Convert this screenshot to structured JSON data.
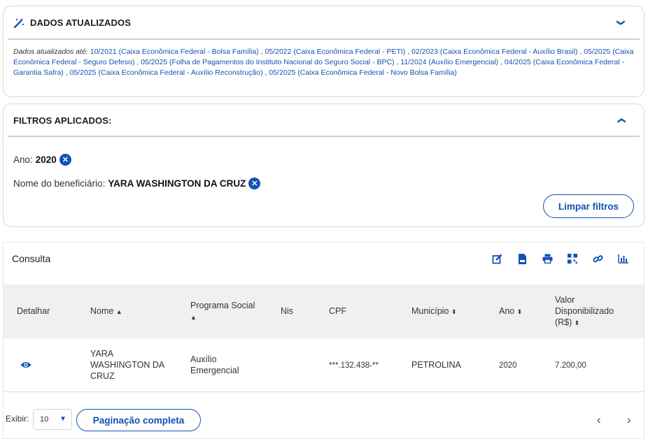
{
  "updated": {
    "title": "DADOS ATUALIZADOS",
    "lead": "Dados atualizados até:",
    "text": " 10/2021 (Caixa Econômica Federal - Bolsa Família) , 05/2022 (Caixa Econômica Federal - PETI) , 02/2023 (Caixa Econômica Federal - Auxílio Brasil) , 05/2025 (Caixa Econômica Federal - Seguro Defeso) , 05/2025 (Folha de Pagamentos do Instituto Nacional do Seguro Social - BPC) , 11/2024 (Auxílio Emergencial) , 04/2025 (Caixa Econômica Federal - Garantia Safra) , 05/2025 (Caixa Econômica Federal - Auxílio Reconstrução) , 05/2025 (Caixa Econômica Federal - Novo Bolsa Família)"
  },
  "filters": {
    "title": "FILTROS APLICADOS:",
    "items": [
      {
        "label": "Ano:",
        "value": "2020"
      },
      {
        "label": "Nome do beneficiário:",
        "value": "YARA WASHINGTON DA CRUZ"
      }
    ],
    "clear_label": "Limpar filtros"
  },
  "consulta": {
    "title": "Consulta",
    "tools": [
      "edit-icon",
      "csv-icon",
      "print-icon",
      "qr-code-icon",
      "link-icon",
      "chart-icon"
    ],
    "columns": {
      "detalhar": "Detalhar",
      "nome": "Nome",
      "programa_l1": "Programa Social",
      "nis": "Nis",
      "cpf": "CPF",
      "municipio": "Município",
      "ano": "Ano",
      "valor_l1": "Valor",
      "valor_l2": "Disponibilizado",
      "valor_l3": "(R$)"
    },
    "rows": [
      {
        "nome_l1": "YARA",
        "nome_l2": "WASHINGTON DA",
        "nome_l3": "CRUZ",
        "programa_l1": "Auxílio",
        "programa_l2": "Emergencial",
        "nis": "",
        "cpf": "***.132.438-**",
        "municipio": "PETROLINA",
        "ano": "2020",
        "valor": "7.200,00"
      }
    ]
  },
  "pager": {
    "exibir_label": "Exibir:",
    "page_size": "10",
    "full_label": "Paginação completa"
  },
  "colors": {
    "accent": "#1351b4",
    "header_bg": "#f0f0f0"
  }
}
